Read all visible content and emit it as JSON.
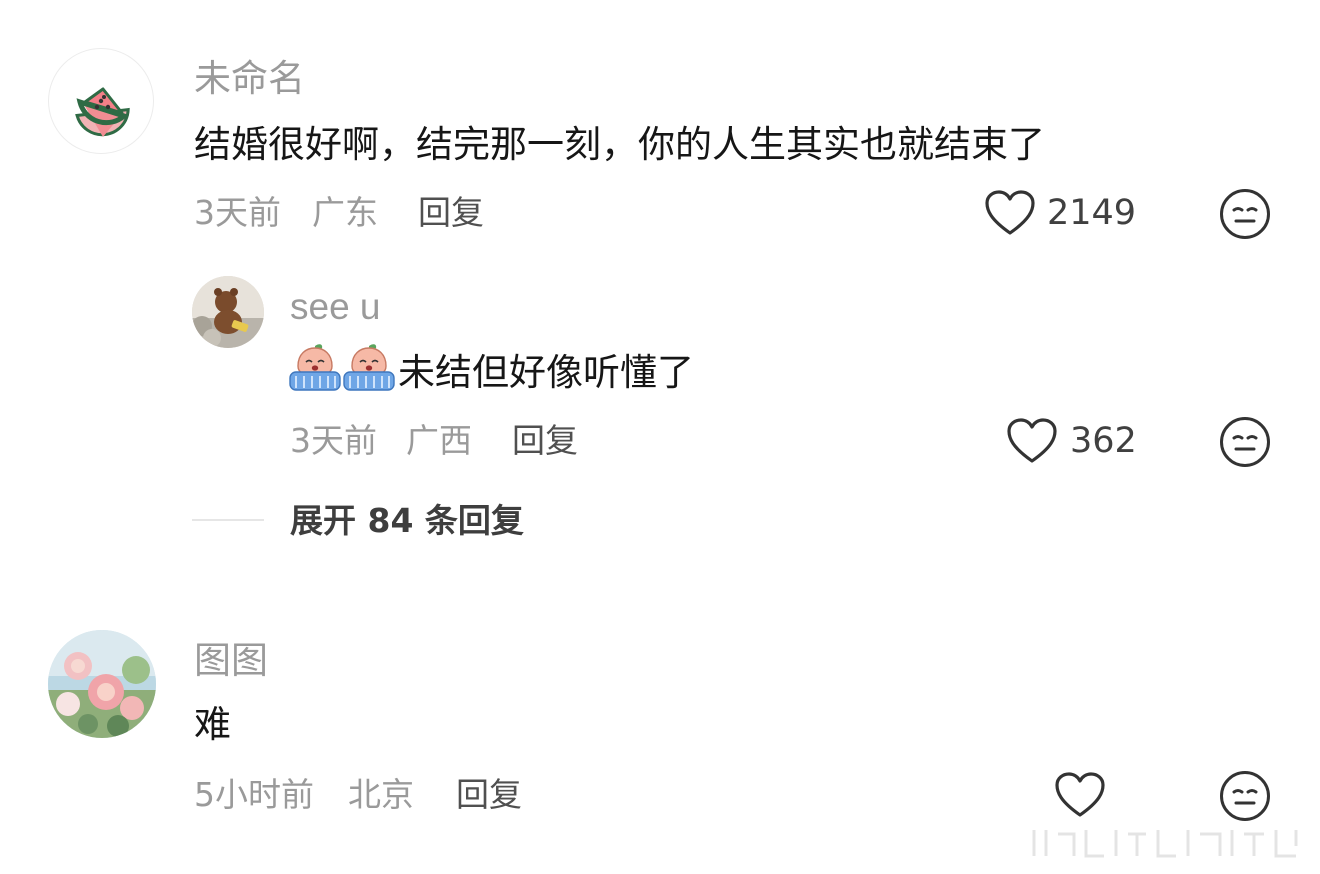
{
  "comments": [
    {
      "username": "未命名",
      "avatar_icon": "watermelon-icon",
      "text": "结婚很好啊，结完那一刻，你的人生其实也就结束了",
      "time": "3天前",
      "location": "广东",
      "reply_label": "回复",
      "likes": "2149",
      "replies": [
        {
          "username": "see u",
          "avatar_icon": "teddy-bear-photo",
          "emojis": [
            "crying-peach-emoji",
            "crying-peach-emoji"
          ],
          "text": "未结但好像听懂了",
          "time": "3天前",
          "location": "广西",
          "reply_label": "回复",
          "likes": "362"
        }
      ],
      "expand_label": "展开 84 条回复"
    },
    {
      "username": "图图",
      "avatar_icon": "peony-painting",
      "text": "难",
      "time": "5小时前",
      "location": "北京",
      "reply_label": "回复",
      "likes": ""
    }
  ],
  "colors": {
    "username": "#9a9a9a",
    "content": "#161616",
    "meta": "#9a9a9a",
    "icon_stroke": "#333333"
  }
}
